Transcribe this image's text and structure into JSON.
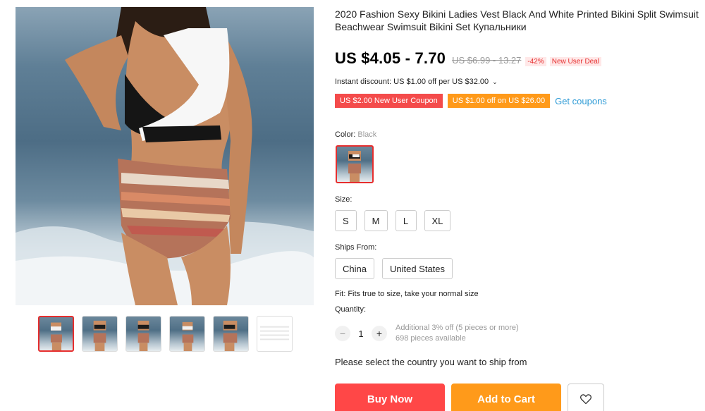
{
  "product": {
    "title": "2020 Fashion Sexy Bikini Ladies Vest Black And White Printed Bikini Split Swimsuit Beachwear Swimsuit Bikini Set Купальники",
    "price": "US $4.05 - 7.70",
    "original_price": "US $6.99 - 13.27",
    "discount": "-42%",
    "new_user_badge": "New User Deal"
  },
  "promotions": {
    "instant_discount": "Instant discount: US $1.00 off per US $32.00",
    "coupons": [
      "US $2.00 New User Coupon",
      "US $1.00 off on US $26.00"
    ],
    "get_coupons": "Get coupons"
  },
  "color": {
    "label": "Color:",
    "value": "Black"
  },
  "size": {
    "label": "Size:",
    "options": [
      "S",
      "M",
      "L",
      "XL"
    ]
  },
  "ships_from": {
    "label": "Ships From:",
    "options": [
      "China",
      "United States"
    ]
  },
  "fit": "Fit: Fits true to size, take your normal size",
  "quantity": {
    "label": "Quantity:",
    "minus": "−",
    "plus": "+",
    "value": "1",
    "additional": "Additional 3% off (5 pieces or more)",
    "available": "698 pieces available"
  },
  "ship_message": "Please select the country you want to ship from",
  "actions": {
    "buy_now": "Buy Now",
    "add_to_cart": "Add to Cart"
  },
  "icons": {
    "wishlist": "heart-icon",
    "dropdown": "chevron-down-icon"
  },
  "colors": {
    "accent_red": "#ff4747",
    "accent_orange": "#ff9a1a",
    "link_blue": "#2e9bd6"
  }
}
